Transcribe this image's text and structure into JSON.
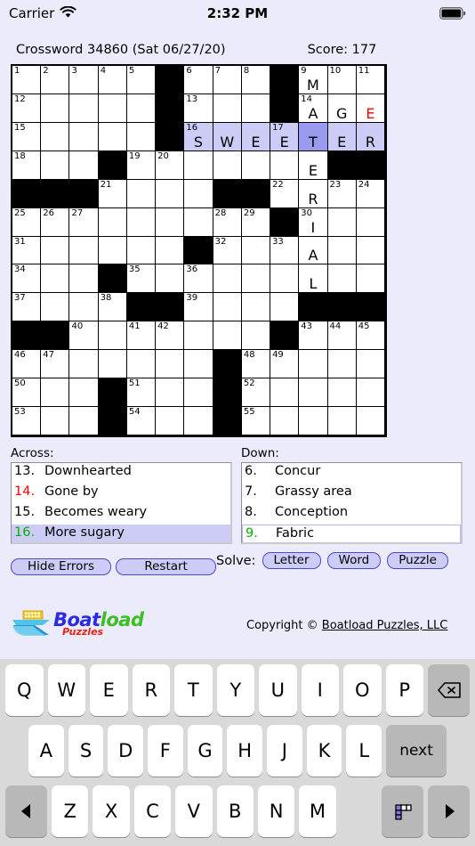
{
  "status_bar": {
    "carrier": "Carrier",
    "wifi_icon": "wifi-icon",
    "time": "2:32 PM",
    "battery_icon": "battery-full-icon"
  },
  "header": {
    "puzzle_title": "Crossword 34860 (Sat 06/27/20)",
    "score_label": "Score:  177"
  },
  "grid": {
    "rows": 13,
    "cols": 13,
    "colors": {
      "highlight": "#ccccf7",
      "cursor": "#9a9aee",
      "error_letter": "#ff0000"
    },
    "cells": [
      [
        {
          "n": "1"
        },
        {
          "n": "2"
        },
        {
          "n": "3"
        },
        {
          "n": "4"
        },
        {
          "n": "5"
        },
        {
          "b": true
        },
        {
          "n": "6"
        },
        {
          "n": "7"
        },
        {
          "n": "8"
        },
        {
          "b": true
        },
        {
          "n": "9",
          "l": "M"
        },
        {
          "n": "10"
        },
        {
          "n": "11"
        }
      ],
      [
        {
          "n": "12"
        },
        {},
        {},
        {},
        {},
        {
          "b": true
        },
        {
          "n": "13"
        },
        {},
        {},
        {
          "b": true
        },
        {
          "n": "14",
          "l": "A"
        },
        {
          "l": "G"
        },
        {
          "l": "E",
          "err": true
        }
      ],
      [
        {
          "n": "15"
        },
        {},
        {},
        {},
        {},
        {
          "b": true
        },
        {
          "n": "16",
          "l": "S",
          "h": true
        },
        {
          "l": "W",
          "h": true
        },
        {
          "l": "E",
          "h": true
        },
        {
          "n": "17",
          "l": "E",
          "h": true
        },
        {
          "l": "T",
          "c": true
        },
        {
          "l": "E",
          "h": true
        },
        {
          "l": "R",
          "h": true
        }
      ],
      [
        {
          "n": "18"
        },
        {},
        {},
        {
          "b": true
        },
        {
          "n": "19"
        },
        {
          "n": "20"
        },
        {},
        {},
        {},
        {},
        {
          "l": "E"
        },
        {
          "b": true
        },
        {
          "b": true
        }
      ],
      [
        {
          "b": true
        },
        {
          "b": true
        },
        {
          "b": true
        },
        {
          "n": "21"
        },
        {},
        {},
        {},
        {
          "b": true
        },
        {
          "b": true
        },
        {
          "n": "22"
        },
        {
          "l": "R"
        },
        {
          "n": "23"
        },
        {
          "n": "24"
        }
      ],
      [
        {
          "n": "25"
        },
        {
          "n": "26"
        },
        {
          "n": "27"
        },
        {},
        {},
        {},
        {},
        {
          "n": "28"
        },
        {
          "n": "29"
        },
        {
          "b": true
        },
        {
          "n": "30",
          "l": "I"
        },
        {},
        {}
      ],
      [
        {
          "n": "31"
        },
        {},
        {},
        {},
        {},
        {},
        {
          "b": true
        },
        {
          "n": "32"
        },
        {},
        {
          "n": "33"
        },
        {
          "l": "A"
        },
        {},
        {}
      ],
      [
        {
          "n": "34"
        },
        {},
        {},
        {
          "b": true
        },
        {
          "n": "35"
        },
        {},
        {
          "n": "36"
        },
        {},
        {},
        {},
        {
          "l": "L"
        },
        {},
        {}
      ],
      [
        {
          "n": "37"
        },
        {},
        {},
        {
          "n": "38"
        },
        {
          "b": true
        },
        {
          "b": true
        },
        {
          "n": "39"
        },
        {},
        {},
        {},
        {
          "b": true
        },
        {
          "b": true
        },
        {
          "b": true
        }
      ],
      [
        {
          "b": true
        },
        {
          "b": true
        },
        {
          "n": "40"
        },
        {},
        {
          "n": "41"
        },
        {
          "n": "42"
        },
        {},
        {},
        {},
        {
          "b": true
        },
        {
          "n": "43"
        },
        {
          "n": "44"
        },
        {
          "n": "45"
        }
      ],
      [
        {
          "n": "46"
        },
        {
          "n": "47"
        },
        {},
        {},
        {},
        {},
        {},
        {
          "b": true
        },
        {
          "n": "48"
        },
        {
          "n": "49"
        },
        {},
        {},
        {}
      ],
      [
        {
          "n": "50"
        },
        {},
        {},
        {
          "b": true
        },
        {
          "n": "51"
        },
        {},
        {},
        {
          "b": true
        },
        {
          "n": "52"
        },
        {},
        {},
        {},
        {}
      ],
      [
        {
          "n": "53"
        },
        {},
        {},
        {
          "b": true
        },
        {
          "n": "54"
        },
        {},
        {},
        {
          "b": true
        },
        {
          "n": "55"
        },
        {},
        {},
        {},
        {}
      ]
    ]
  },
  "clues": {
    "across": {
      "heading": "Across:",
      "items": [
        {
          "num": "13.",
          "text": "Downhearted",
          "state": "normal"
        },
        {
          "num": "14.",
          "text": "Gone by",
          "state": "error"
        },
        {
          "num": "15.",
          "text": "Becomes weary",
          "state": "normal"
        },
        {
          "num": "16.",
          "text": "More sugary",
          "state": "selected"
        }
      ]
    },
    "down": {
      "heading": "Down:",
      "items": [
        {
          "num": "6.",
          "text": "Concur",
          "state": "normal"
        },
        {
          "num": "7.",
          "text": "Grassy area",
          "state": "normal"
        },
        {
          "num": "8.",
          "text": "Conception",
          "state": "normal"
        },
        {
          "num": "9.",
          "text": "Fabric",
          "state": "focused"
        }
      ]
    }
  },
  "controls": {
    "hide_errors": "Hide Errors",
    "restart": "Restart",
    "solve_label": "Solve:",
    "solve_letter": "Letter",
    "solve_word": "Word",
    "solve_puzzle": "Puzzle"
  },
  "footer": {
    "logo_boat": "Boat",
    "logo_load": "load",
    "logo_puzzles": "Puzzles",
    "copyright_prefix": "Copyright © ",
    "copyright_link": "Boatload Puzzles, LLC"
  },
  "keyboard": {
    "row1": [
      "Q",
      "W",
      "E",
      "R",
      "T",
      "Y",
      "U",
      "I",
      "O",
      "P"
    ],
    "row2": [
      "A",
      "S",
      "D",
      "F",
      "G",
      "H",
      "J",
      "K",
      "L"
    ],
    "row3": [
      "Z",
      "X",
      "C",
      "V",
      "B",
      "N",
      "M"
    ],
    "backspace_icon": "backspace-icon",
    "next_label": "next",
    "left_arrow_icon": "arrow-left-icon",
    "grid_toggle_icon": "crossword-grid-icon",
    "right_arrow_icon": "arrow-right-icon"
  }
}
